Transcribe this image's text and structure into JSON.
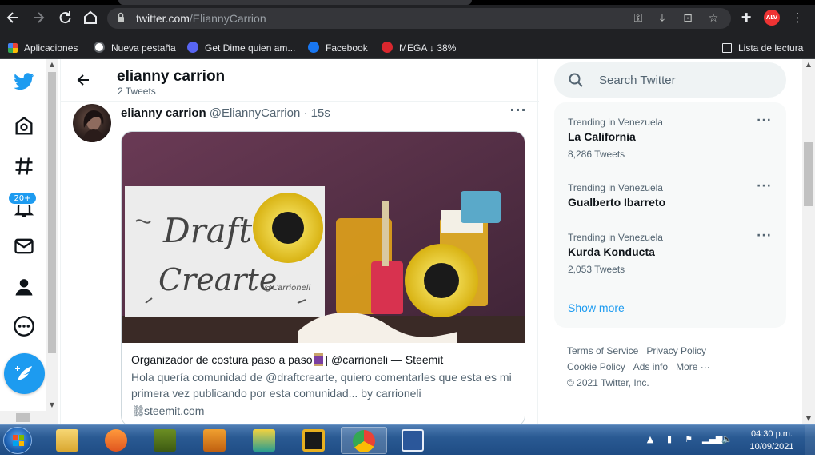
{
  "browser": {
    "url_host": "twitter.com",
    "url_path": "/EliannyCarrion",
    "bookmarks": [
      {
        "label": "Aplicaciones",
        "color": "#f4b400"
      },
      {
        "label": "Nueva pestaña",
        "color": "#ffffff"
      },
      {
        "label": "Get Dime quien am...",
        "color": "#5865f2"
      },
      {
        "label": "Facebook",
        "color": "#1877f2"
      },
      {
        "label": "MEGA ↓ 38%",
        "color": "#d9272e"
      }
    ],
    "reading_list": "Lista de lectura",
    "extension_badge": "ALV"
  },
  "twitter": {
    "notifications_badge": "20+",
    "header": {
      "name": "elianny carrion",
      "tweet_count": "2 Tweets"
    },
    "tweet": {
      "name": "elianny carrion",
      "handle": "@EliannyCarrion · 15s",
      "more": "···",
      "card": {
        "title_before": "Organizador de costura paso a paso",
        "title_after": "| @carrioneli — Steemit",
        "description": "Hola quería comunidad de @draftcrearte, quiero comentarles que esta es mi primera vez publicando por esta comunidad... by carrioneli",
        "link": "steemit.com",
        "image_text_1": "Draft",
        "image_text_2": "Crearte",
        "image_text_3": "@Carrioneli"
      }
    },
    "search": {
      "placeholder": "Search Twitter"
    },
    "trends": [
      {
        "context": "Trending in Venezuela",
        "topic": "La California",
        "count": "8,286 Tweets"
      },
      {
        "context": "Trending in Venezuela",
        "topic": "Gualberto Ibarreto",
        "count": ""
      },
      {
        "context": "Trending in Venezuela",
        "topic": "Kurda Konducta",
        "count": "2,053 Tweets"
      }
    ],
    "show_more": "Show more",
    "footer": {
      "terms": "Terms of Service",
      "privacy": "Privacy Policy",
      "cookie": "Cookie Policy",
      "ads": "Ads info",
      "more": "More ···",
      "copyright": "© 2021 Twitter, Inc."
    },
    "accent": "#1d9bf0"
  },
  "taskbar": {
    "time": "04:30 p.m.",
    "date": "10/09/2021"
  }
}
